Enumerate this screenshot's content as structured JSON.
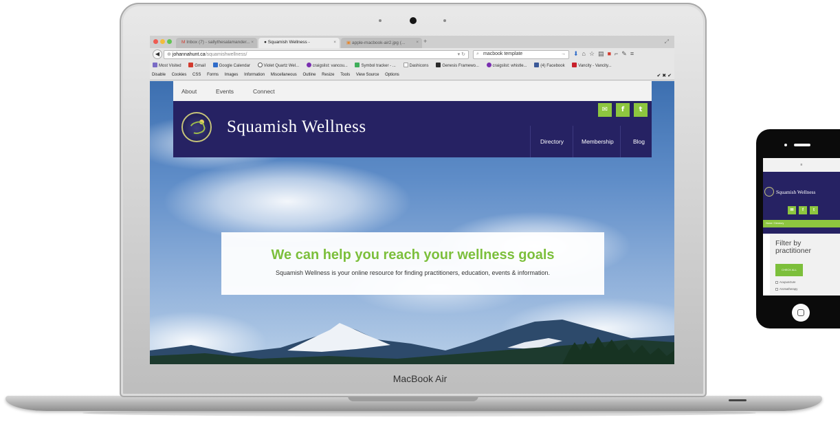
{
  "laptop": {
    "brand_label": "MacBook Air"
  },
  "browser": {
    "tabs": [
      {
        "title": "Inbox (7) - sallythesalamander..."
      },
      {
        "title": "Squamish Wellness -"
      },
      {
        "title": "apple-macbook-air2.jpg (..."
      }
    ],
    "url": {
      "host": "johannahunt.ca",
      "path": "/squamishwellness/"
    },
    "search": {
      "value": "macbook template"
    },
    "bookmarks": [
      "Most Visited",
      "Gmail",
      "Google Calendar",
      "Violet Quartz Wel...",
      "craigslist: vancou...",
      "Symbol tracker - ...",
      "Dashicons",
      "Genesis Framewo...",
      "craigslist: whistle...",
      "(4) Facebook",
      "Vancity - Vancity..."
    ],
    "dev_toolbar": [
      "Disable",
      "Cookies",
      "CSS",
      "Forms",
      "Images",
      "Information",
      "Miscellaneous",
      "Outline",
      "Resize",
      "Tools",
      "View Source",
      "Options"
    ]
  },
  "site": {
    "top_links": [
      "About",
      "Events",
      "Connect"
    ],
    "title": "Squamish Wellness",
    "nav": [
      "Directory",
      "Membership",
      "Blog"
    ],
    "hero": {
      "heading": "We can help you reach your wellness goals",
      "text": "Squamish Wellness is your online resource for finding practitioners, education, events & information."
    }
  },
  "phone": {
    "title": "Squamish Wellness",
    "breadcrumb": "Home / Directory",
    "filter_heading": "Filter by practitioner",
    "check_all": "CHECK ALL",
    "options": [
      "Acupuncture",
      "Aromatherapy"
    ]
  },
  "colors": {
    "brand_navy": "#262263",
    "brand_green": "#8dc63f",
    "hero_heading": "#7cbf3b"
  },
  "icons": {
    "social": [
      "email-icon",
      "facebook-icon",
      "twitter-icon"
    ]
  }
}
